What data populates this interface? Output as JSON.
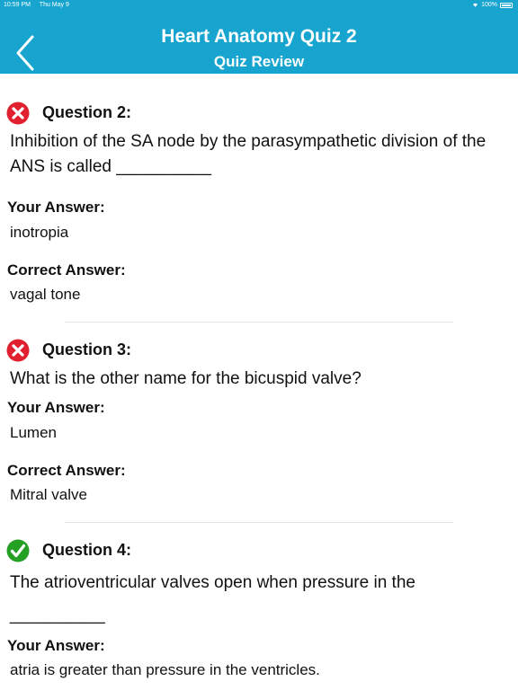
{
  "status_bar": {
    "time": "10:59 PM",
    "date": "Thu May 9",
    "battery": "100%"
  },
  "header": {
    "title": "Heart Anatomy Quiz 2",
    "subtitle": "Quiz Review"
  },
  "questions": [
    {
      "label": "Question 2:",
      "result": "incorrect",
      "text": "Inhibition of the SA node by the parasympathetic division of the ANS is called __________",
      "your_answer_label": "Your Answer:",
      "your_answer": "inotropia",
      "correct_answer_label": "Correct Answer:",
      "correct_answer": "vagal tone"
    },
    {
      "label": "Question 3:",
      "result": "incorrect",
      "text": "What is the other name for the bicuspid valve?",
      "your_answer_label": "Your Answer:",
      "your_answer": "Lumen",
      "correct_answer_label": "Correct Answer:",
      "correct_answer": "Mitral valve"
    },
    {
      "label": "Question 4:",
      "result": "correct",
      "text": "The atrioventricular valves open when pressure in the __________",
      "your_answer_label": "Your Answer:",
      "your_answer": "atria is greater than pressure in the ventricles."
    }
  ],
  "icons": {
    "back": "chevron-left-icon",
    "incorrect": "x-circle-icon",
    "correct": "checkmark-circle-icon"
  },
  "colors": {
    "header_bg": "#17a5cf",
    "incorrect": "#e0202e",
    "correct": "#25a025"
  }
}
